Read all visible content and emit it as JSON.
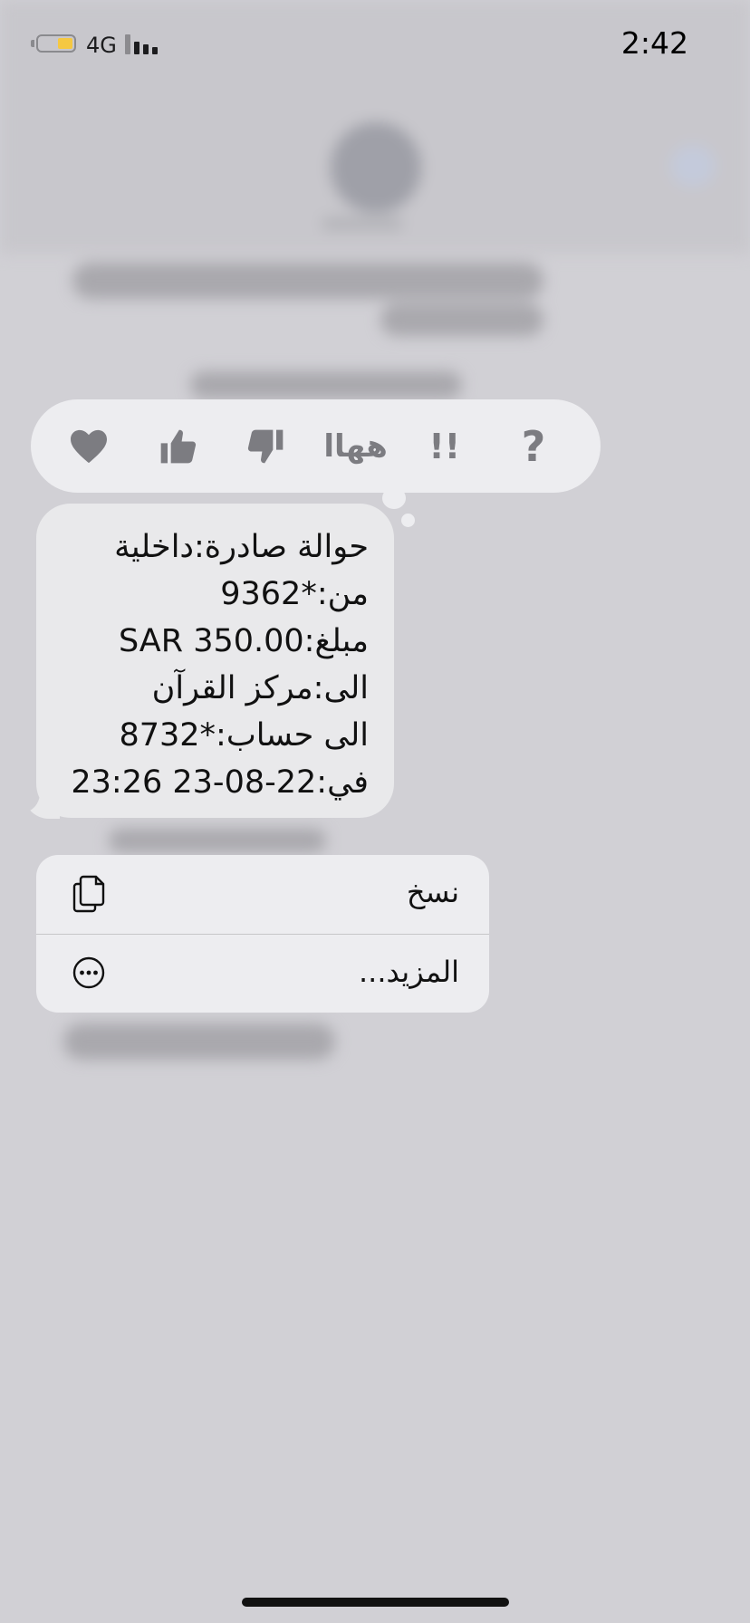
{
  "status_bar": {
    "network": "4G",
    "time": "2:42",
    "battery_color": "#f5c842"
  },
  "reactions": [
    {
      "name": "heart-icon"
    },
    {
      "name": "thumbs-up-icon"
    },
    {
      "name": "thumbs-down-icon"
    },
    {
      "name": "haha-reaction",
      "label": "ههاا"
    },
    {
      "name": "exclamation-reaction",
      "label": "!!"
    },
    {
      "name": "question-reaction",
      "label": "?"
    }
  ],
  "message": {
    "lines": [
      "حوالة صادرة:داخلية",
      "من:*9362",
      "مبلغ:SAR 350.00",
      "الى:مركز القرآن",
      "الى حساب:*8732",
      "في:22-08-23 23:26"
    ]
  },
  "context_menu": {
    "copy_label": "نسخ",
    "more_label": "المزيد..."
  }
}
